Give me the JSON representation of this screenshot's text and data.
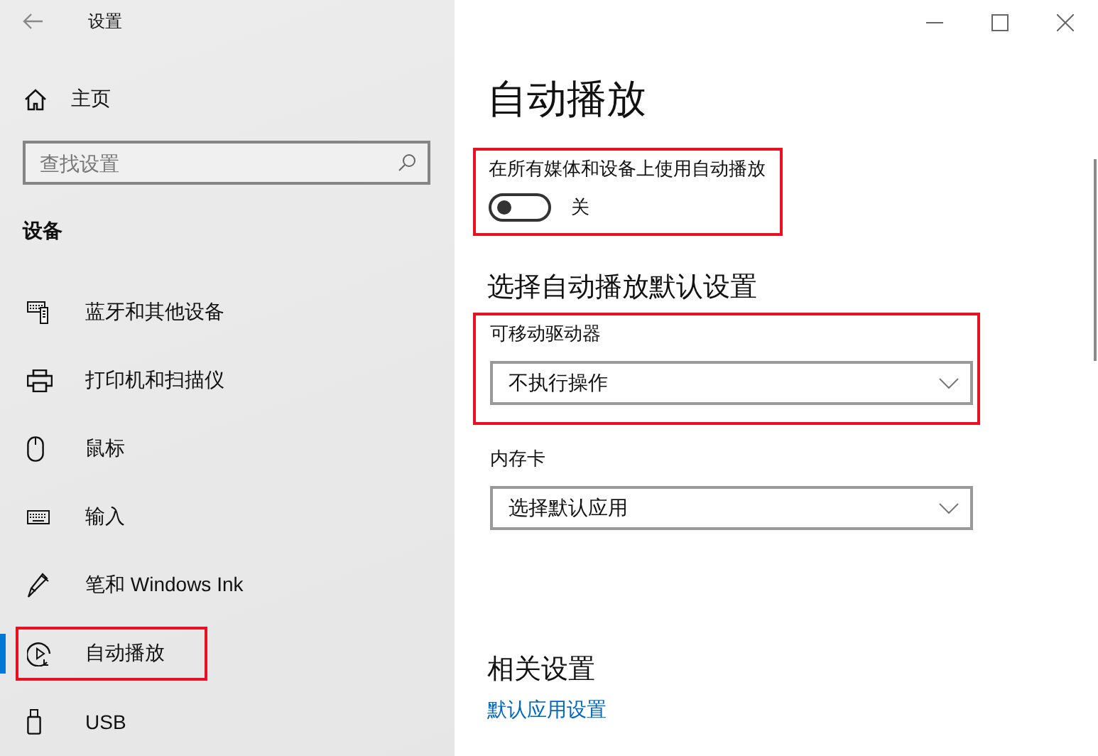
{
  "window": {
    "title": "设置"
  },
  "sidebar": {
    "home": "主页",
    "search": {
      "placeholder": "查找设置"
    },
    "section": "设备",
    "items": [
      {
        "label": "蓝牙和其他设备",
        "selected": false,
        "highlighted": false
      },
      {
        "label": "打印机和扫描仪",
        "selected": false,
        "highlighted": false
      },
      {
        "label": "鼠标",
        "selected": false,
        "highlighted": false
      },
      {
        "label": "输入",
        "selected": false,
        "highlighted": false
      },
      {
        "label": "笔和 Windows Ink",
        "selected": false,
        "highlighted": false
      },
      {
        "label": "自动播放",
        "selected": true,
        "highlighted": true
      },
      {
        "label": "USB",
        "selected": false,
        "highlighted": false
      }
    ]
  },
  "page": {
    "title": "自动播放",
    "toggle": {
      "label": "在所有媒体和设备上使用自动播放",
      "on": false,
      "state_text": "关",
      "highlighted": true
    },
    "defaults_heading": "选择自动播放默认设置",
    "dropdowns": [
      {
        "label": "可移动驱动器",
        "value": "不执行操作",
        "highlighted": true
      },
      {
        "label": "内存卡",
        "value": "选择默认应用",
        "highlighted": false
      }
    ],
    "related_heading": "相关设置",
    "related_link": "默认应用设置"
  }
}
